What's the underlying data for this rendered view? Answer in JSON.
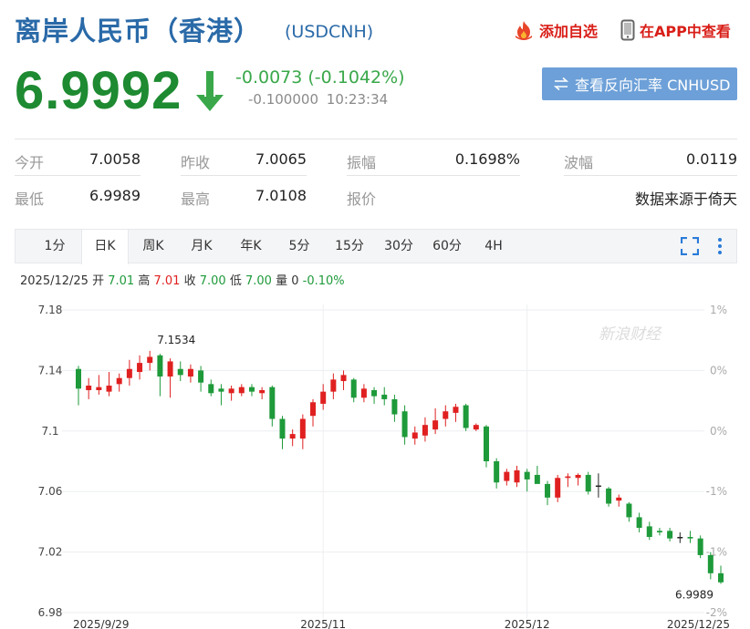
{
  "header": {
    "title": "离岸人民币（香港）",
    "code": "(USDCNH)",
    "add_fav_label": "添加自选",
    "app_label": "在APP中查看"
  },
  "quote": {
    "price": "6.9992",
    "change": "-0.0073 (-0.1042%)",
    "sub_value": "-0.100000",
    "time": "10:23:34",
    "reverse_button": "查看反向汇率 CNHUSD"
  },
  "stats": {
    "row1": [
      {
        "label": "今开",
        "value": "7.0058"
      },
      {
        "label": "昨收",
        "value": "7.0065"
      },
      {
        "label": "振幅",
        "value": "0.1698%"
      },
      {
        "label": "波幅",
        "value": "0.0119"
      }
    ],
    "row2": [
      {
        "label": "最低",
        "value": "6.9989"
      },
      {
        "label": "最高",
        "value": "7.0108"
      },
      {
        "label": "报价",
        "value": "数据来源于倚天"
      }
    ]
  },
  "tabs": [
    "1分",
    "日K",
    "周K",
    "月K",
    "年K",
    "5分",
    "15分",
    "30分",
    "60分",
    "4H"
  ],
  "active_tab": "日K",
  "ohlc": {
    "date": "2025/12/25",
    "open_label": "开",
    "open": "7.01",
    "high_label": "高",
    "high": "7.01",
    "close_label": "收",
    "close": "7.00",
    "low_label": "低",
    "low": "7.00",
    "vol_label": "量",
    "vol": "0",
    "pct": "-0.10%"
  },
  "colors": {
    "up": "#e02020",
    "down": "#1e9a3a",
    "flat": "#222222",
    "title": "#2a6aa8",
    "button": "#6da0d8"
  },
  "chart_data": {
    "type": "candlestick",
    "watermark": "新浪财经",
    "y_ticks": [
      "7.18",
      "7.14",
      "7.1",
      "7.06",
      "7.02",
      "6.98"
    ],
    "y_range": [
      6.98,
      7.18
    ],
    "right_ticks": [
      "1%",
      "0%",
      "0%",
      "-1%",
      "-1%",
      "-2%"
    ],
    "x_labels": [
      "2025/9/29",
      "2025/11",
      "2025/12",
      "2025/12/25"
    ],
    "x_label_index": [
      0,
      24,
      44,
      63
    ],
    "annotations": [
      {
        "text": "7.1534",
        "index": 7
      },
      {
        "text": "6.9989",
        "index": 63
      }
    ],
    "candles": [
      {
        "o": 7.141,
        "h": 7.143,
        "l": 7.117,
        "c": 7.128
      },
      {
        "o": 7.127,
        "h": 7.135,
        "l": 7.121,
        "c": 7.13
      },
      {
        "o": 7.127,
        "h": 7.137,
        "l": 7.124,
        "c": 7.129
      },
      {
        "o": 7.126,
        "h": 7.139,
        "l": 7.123,
        "c": 7.13
      },
      {
        "o": 7.131,
        "h": 7.138,
        "l": 7.126,
        "c": 7.135
      },
      {
        "o": 7.135,
        "h": 7.147,
        "l": 7.13,
        "c": 7.141
      },
      {
        "o": 7.139,
        "h": 7.15,
        "l": 7.134,
        "c": 7.145
      },
      {
        "o": 7.145,
        "h": 7.153,
        "l": 7.14,
        "c": 7.149
      },
      {
        "o": 7.15,
        "h": 7.151,
        "l": 7.123,
        "c": 7.136
      },
      {
        "o": 7.136,
        "h": 7.148,
        "l": 7.122,
        "c": 7.146
      },
      {
        "o": 7.141,
        "h": 7.146,
        "l": 7.133,
        "c": 7.137
      },
      {
        "o": 7.136,
        "h": 7.144,
        "l": 7.132,
        "c": 7.141
      },
      {
        "o": 7.14,
        "h": 7.143,
        "l": 7.126,
        "c": 7.132
      },
      {
        "o": 7.131,
        "h": 7.134,
        "l": 7.123,
        "c": 7.125
      },
      {
        "o": 7.128,
        "h": 7.131,
        "l": 7.117,
        "c": 7.126
      },
      {
        "o": 7.125,
        "h": 7.13,
        "l": 7.12,
        "c": 7.128
      },
      {
        "o": 7.125,
        "h": 7.131,
        "l": 7.123,
        "c": 7.129
      },
      {
        "o": 7.129,
        "h": 7.131,
        "l": 7.123,
        "c": 7.126
      },
      {
        "o": 7.125,
        "h": 7.129,
        "l": 7.121,
        "c": 7.127
      },
      {
        "o": 7.129,
        "h": 7.13,
        "l": 7.103,
        "c": 7.108
      },
      {
        "o": 7.108,
        "h": 7.11,
        "l": 7.088,
        "c": 7.095
      },
      {
        "o": 7.095,
        "h": 7.101,
        "l": 7.09,
        "c": 7.098
      },
      {
        "o": 7.095,
        "h": 7.111,
        "l": 7.088,
        "c": 7.108
      },
      {
        "o": 7.11,
        "h": 7.121,
        "l": 7.103,
        "c": 7.119
      },
      {
        "o": 7.118,
        "h": 7.131,
        "l": 7.114,
        "c": 7.126
      },
      {
        "o": 7.126,
        "h": 7.138,
        "l": 7.121,
        "c": 7.134
      },
      {
        "o": 7.133,
        "h": 7.14,
        "l": 7.127,
        "c": 7.137
      },
      {
        "o": 7.134,
        "h": 7.135,
        "l": 7.119,
        "c": 7.122
      },
      {
        "o": 7.122,
        "h": 7.131,
        "l": 7.119,
        "c": 7.128
      },
      {
        "o": 7.127,
        "h": 7.129,
        "l": 7.118,
        "c": 7.123
      },
      {
        "o": 7.124,
        "h": 7.129,
        "l": 7.117,
        "c": 7.121
      },
      {
        "o": 7.121,
        "h": 7.124,
        "l": 7.106,
        "c": 7.111
      },
      {
        "o": 7.113,
        "h": 7.117,
        "l": 7.091,
        "c": 7.096
      },
      {
        "o": 7.095,
        "h": 7.103,
        "l": 7.091,
        "c": 7.099
      },
      {
        "o": 7.097,
        "h": 7.109,
        "l": 7.093,
        "c": 7.104
      },
      {
        "o": 7.101,
        "h": 7.115,
        "l": 7.098,
        "c": 7.107
      },
      {
        "o": 7.108,
        "h": 7.117,
        "l": 7.103,
        "c": 7.113
      },
      {
        "o": 7.112,
        "h": 7.118,
        "l": 7.106,
        "c": 7.116
      },
      {
        "o": 7.117,
        "h": 7.118,
        "l": 7.1,
        "c": 7.102
      },
      {
        "o": 7.101,
        "h": 7.105,
        "l": 7.1,
        "c": 7.104
      },
      {
        "o": 7.103,
        "h": 7.104,
        "l": 7.076,
        "c": 7.08
      },
      {
        "o": 7.08,
        "h": 7.082,
        "l": 7.062,
        "c": 7.066
      },
      {
        "o": 7.067,
        "h": 7.075,
        "l": 7.064,
        "c": 7.073
      },
      {
        "o": 7.066,
        "h": 7.077,
        "l": 7.063,
        "c": 7.074
      },
      {
        "o": 7.073,
        "h": 7.075,
        "l": 7.06,
        "c": 7.068
      },
      {
        "o": 7.071,
        "h": 7.077,
        "l": 7.067,
        "c": 7.065
      },
      {
        "o": 7.065,
        "h": 7.067,
        "l": 7.051,
        "c": 7.056
      },
      {
        "o": 7.056,
        "h": 7.071,
        "l": 7.053,
        "c": 7.069
      },
      {
        "o": 7.069,
        "h": 7.072,
        "l": 7.063,
        "c": 7.07
      },
      {
        "o": 7.069,
        "h": 7.072,
        "l": 7.064,
        "c": 7.071
      },
      {
        "o": 7.071,
        "h": 7.073,
        "l": 7.058,
        "c": 7.06
      },
      {
        "o": 7.064,
        "h": 7.072,
        "l": 7.056,
        "c": 7.064
      },
      {
        "o": 7.062,
        "h": 7.063,
        "l": 7.05,
        "c": 7.052
      },
      {
        "o": 7.054,
        "h": 7.058,
        "l": 7.05,
        "c": 7.056
      },
      {
        "o": 7.052,
        "h": 7.053,
        "l": 7.04,
        "c": 7.043
      },
      {
        "o": 7.043,
        "h": 7.046,
        "l": 7.033,
        "c": 7.036
      },
      {
        "o": 7.037,
        "h": 7.04,
        "l": 7.028,
        "c": 7.03
      },
      {
        "o": 7.034,
        "h": 7.036,
        "l": 7.031,
        "c": 7.033
      },
      {
        "o": 7.034,
        "h": 7.036,
        "l": 7.027,
        "c": 7.029
      },
      {
        "o": 7.03,
        "h": 7.033,
        "l": 7.026,
        "c": 7.03
      },
      {
        "o": 7.03,
        "h": 7.034,
        "l": 7.026,
        "c": 7.029
      },
      {
        "o": 7.029,
        "h": 7.031,
        "l": 7.016,
        "c": 7.018
      },
      {
        "o": 7.018,
        "h": 7.02,
        "l": 7.002,
        "c": 7.006
      },
      {
        "o": 7.006,
        "h": 7.011,
        "l": 6.999,
        "c": 7.0
      }
    ]
  }
}
